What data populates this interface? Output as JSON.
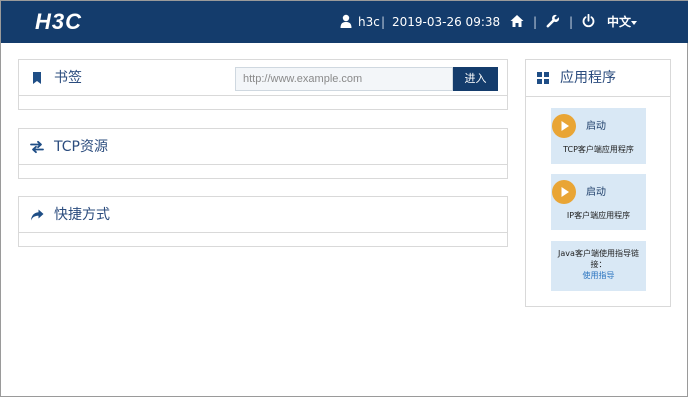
{
  "header": {
    "logo": "H3C",
    "user": "h3c",
    "separator": "|",
    "datetime": "2019-03-26 09:38",
    "language": "中文",
    "icons": [
      "user-icon",
      "home-icon",
      "wrench-icon",
      "power-icon",
      "caret-down-icon"
    ],
    "background": "#143c6c"
  },
  "bookmarks": {
    "title": "书签",
    "icon": "bookmark-icon",
    "url_placeholder": "http://www.example.com",
    "url_value": "",
    "go_label": "进入"
  },
  "tcp_resources": {
    "title": "TCP资源",
    "icon": "exchange-arrows-icon"
  },
  "shortcuts": {
    "title": "快捷方式",
    "icon": "share-arrow-icon"
  },
  "apps": {
    "title": "应用程序",
    "icon": "grid-icon",
    "tcp_client": {
      "start_label": "启动",
      "name": "TCP客户端应用程序"
    },
    "ip_client": {
      "start_label": "启动",
      "name": "IP客户端应用程序"
    },
    "java_guide": {
      "text": "Java客户端使用指导链接：",
      "link": "使用指导"
    },
    "accent": "#e9a535",
    "card_bg": "#d9e8f5"
  }
}
